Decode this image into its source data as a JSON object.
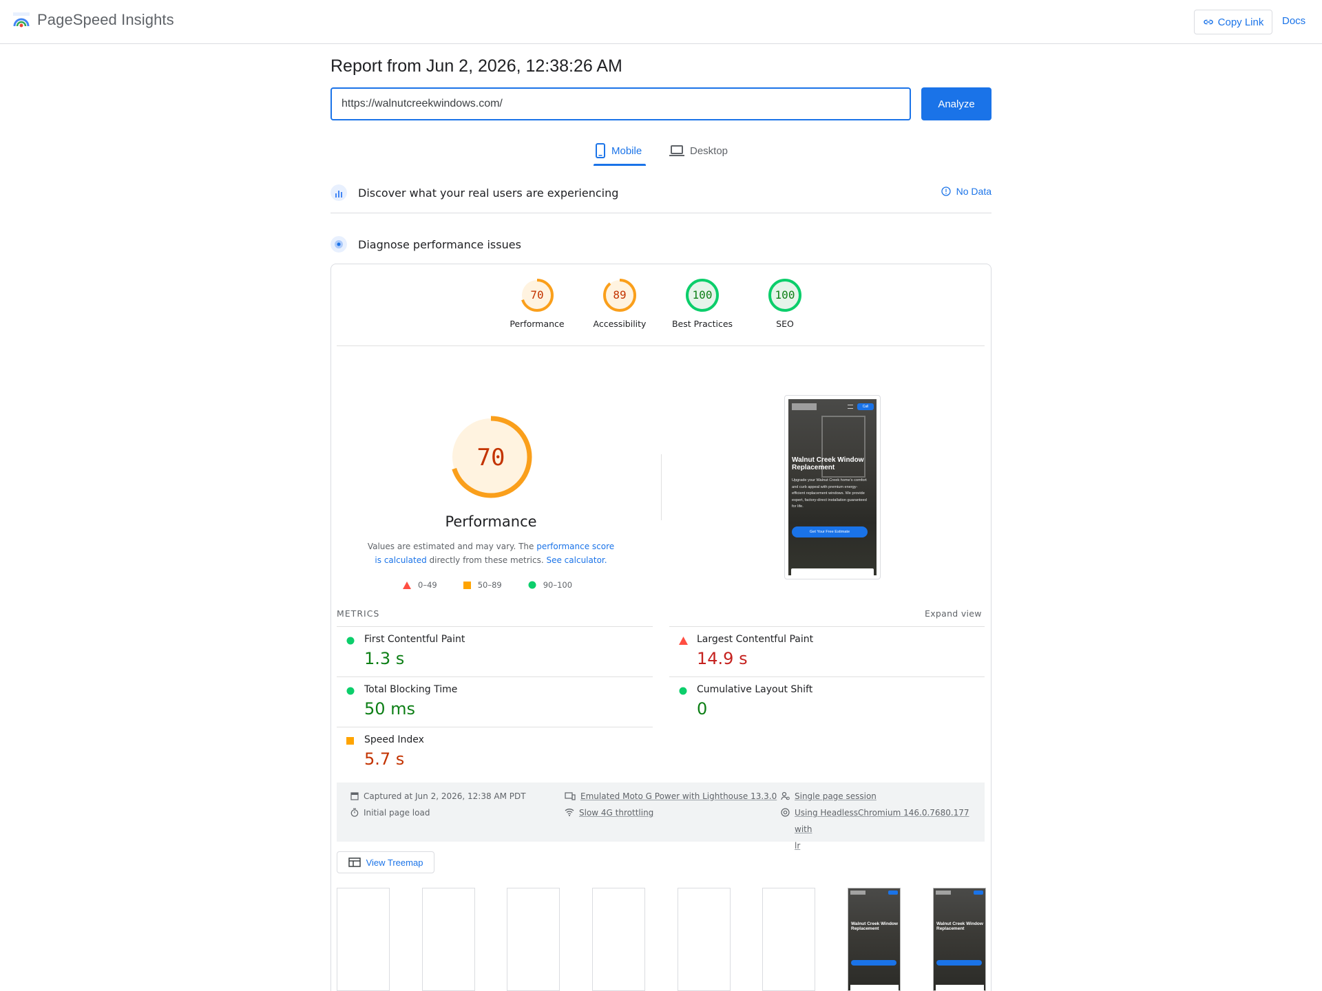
{
  "app": {
    "name": "PageSpeed Insights",
    "copy_link": "Copy Link",
    "docs": "Docs"
  },
  "report": {
    "title": "Report from Jun 2, 2026, 12:38:26 AM",
    "url_value": "https://walnutcreekwindows.com/",
    "analyze": "Analyze"
  },
  "tabs": {
    "mobile": "Mobile",
    "desktop": "Desktop",
    "selected": "Mobile"
  },
  "sections": {
    "real_users": "Discover what your real users are experiencing",
    "no_data": "No Data",
    "diagnose": "Diagnose performance issues"
  },
  "gauges": [
    {
      "label": "Performance",
      "score": "70",
      "value": 70,
      "color": "#fa9f1b"
    },
    {
      "label": "Accessibility",
      "score": "89",
      "value": 89,
      "color": "#fa9f1b"
    },
    {
      "label": "Best Practices",
      "score": "100",
      "value": 100,
      "color": "#0cce6b"
    },
    {
      "label": "SEO",
      "score": "100",
      "value": 100,
      "color": "#0cce6b"
    }
  ],
  "performance": {
    "score": "70",
    "value": 70,
    "title": "Performance",
    "desc_prefix": "Values are estimated and may vary. The ",
    "desc_link1": "performance score is calculated",
    "desc_middle": " directly from these metrics. ",
    "desc_link2": "See calculator."
  },
  "legend": {
    "poor": "0–49",
    "average": "50–89",
    "good": "90–100"
  },
  "screenshot": {
    "call_badge": "Call",
    "headline": "Walnut Creek Window Replacement",
    "body": "Upgrade your Walnut Creek home's comfort and curb appeal with premium energy-efficient replacement windows. We provide expert, factory-direct installation guaranteed for life.",
    "cta": "Get Your Free Estimate"
  },
  "metrics": {
    "header": "METRICS",
    "expand": "Expand view",
    "items": [
      {
        "name": "First Contentful Paint",
        "value": "1.3 s",
        "rating": "good"
      },
      {
        "name": "Largest Contentful Paint",
        "value": "14.9 s",
        "rating": "poor"
      },
      {
        "name": "Total Blocking Time",
        "value": "50 ms",
        "rating": "good"
      },
      {
        "name": "Cumulative Layout Shift",
        "value": "0",
        "rating": "good"
      },
      {
        "name": "Speed Index",
        "value": "5.7 s",
        "rating": "average"
      }
    ]
  },
  "runtime": {
    "captured": "Captured at Jun 2, 2026, 12:38 AM PDT",
    "initial_load": "Initial page load",
    "device": "Emulated Moto G Power with Lighthouse 13.3.0",
    "throttling": "Slow 4G throttling",
    "session": "Single page session",
    "browser_line1": "Using HeadlessChromium 146.0.7680.177 with",
    "browser_line2": "lr"
  },
  "treemap": "View Treemap",
  "filmstrip": {
    "thumb_headline": "Walnut Creek Window Replacement",
    "frames_filled": [
      false,
      false,
      false,
      false,
      false,
      false,
      true,
      true
    ]
  },
  "colors": {
    "accent": "#1a73e8",
    "good": "#0cce6b",
    "average": "#ffa400",
    "poor": "#ff4e42"
  }
}
